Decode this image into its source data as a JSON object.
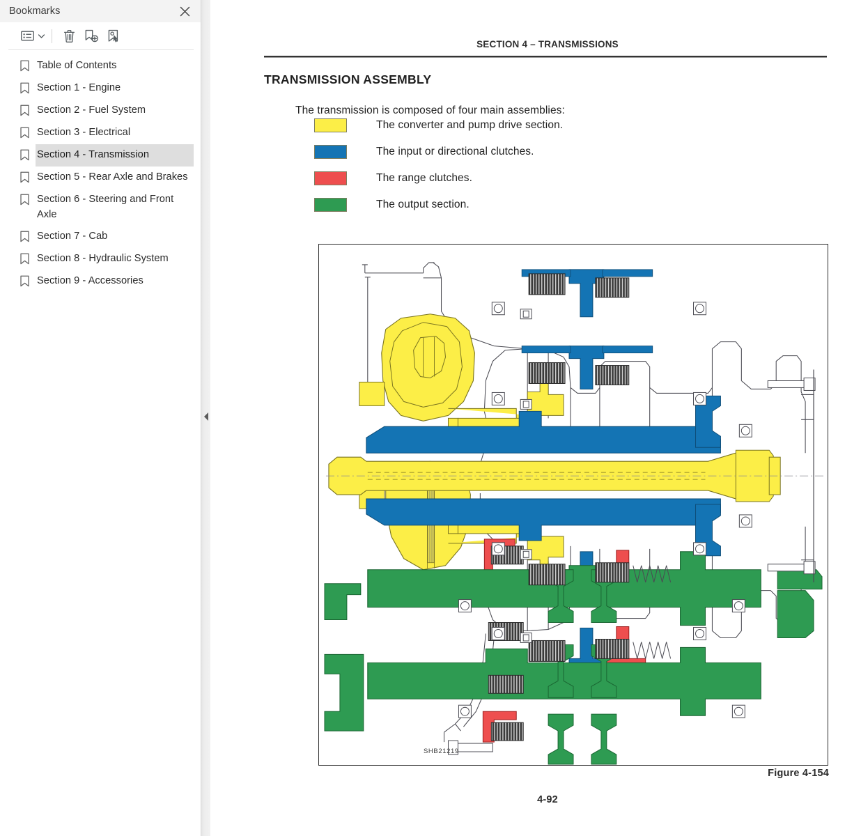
{
  "panel": {
    "title": "Bookmarks",
    "close_icon": "close-icon",
    "toolbar": {
      "list_options_label": "list-options-icon",
      "caret_label": "chevron-down-icon",
      "delete_label": "trash-icon",
      "new_bookmark_label": "new-bookmark-icon",
      "expand_bookmark_label": "bookmark-pointer-icon"
    },
    "items": [
      {
        "label": "Table of Contents",
        "selected": false
      },
      {
        "label": "Section 1 - Engine",
        "selected": false
      },
      {
        "label": "Section 2 - Fuel System",
        "selected": false
      },
      {
        "label": "Section 3 - Electrical",
        "selected": false
      },
      {
        "label": "Section 4 - Transmission",
        "selected": true
      },
      {
        "label": "Section 5 - Rear Axle and Brakes",
        "selected": false
      },
      {
        "label": "Section 6 - Steering and Front Axle",
        "selected": false
      },
      {
        "label": "Section 7 - Cab",
        "selected": false
      },
      {
        "label": "Section 8 - Hydraulic System",
        "selected": false
      },
      {
        "label": "Section 9 - Accessories",
        "selected": false
      }
    ]
  },
  "splitter": {
    "collapse_icon": "collapse-left-arrow-icon"
  },
  "document": {
    "running_head": "SECTION 4 – TRANSMISSIONS",
    "section_title": "TRANSMISSION ASSEMBLY",
    "intro": "The transmission is composed of four main assemblies:",
    "legend": [
      {
        "color": "#FCEE47",
        "text": "The converter and pump drive section."
      },
      {
        "color": "#1474B4",
        "text": "The input or directional clutches."
      },
      {
        "color": "#EE4E4E",
        "text": "The range clutches."
      },
      {
        "color": "#2E9B52",
        "text": "The output section."
      }
    ],
    "figure": {
      "drawing_id": "SHB21219",
      "caption": "Figure 4-154"
    },
    "page_number": "4-92"
  },
  "colors": {
    "converter_yellow": "#FCEE47",
    "input_blue": "#1474B4",
    "range_red": "#EE4E4E",
    "output_green": "#2E9B52",
    "line": "#4a4a52",
    "selected_bg": "#dedede",
    "panel_header_bg": "#f3f3f3"
  }
}
